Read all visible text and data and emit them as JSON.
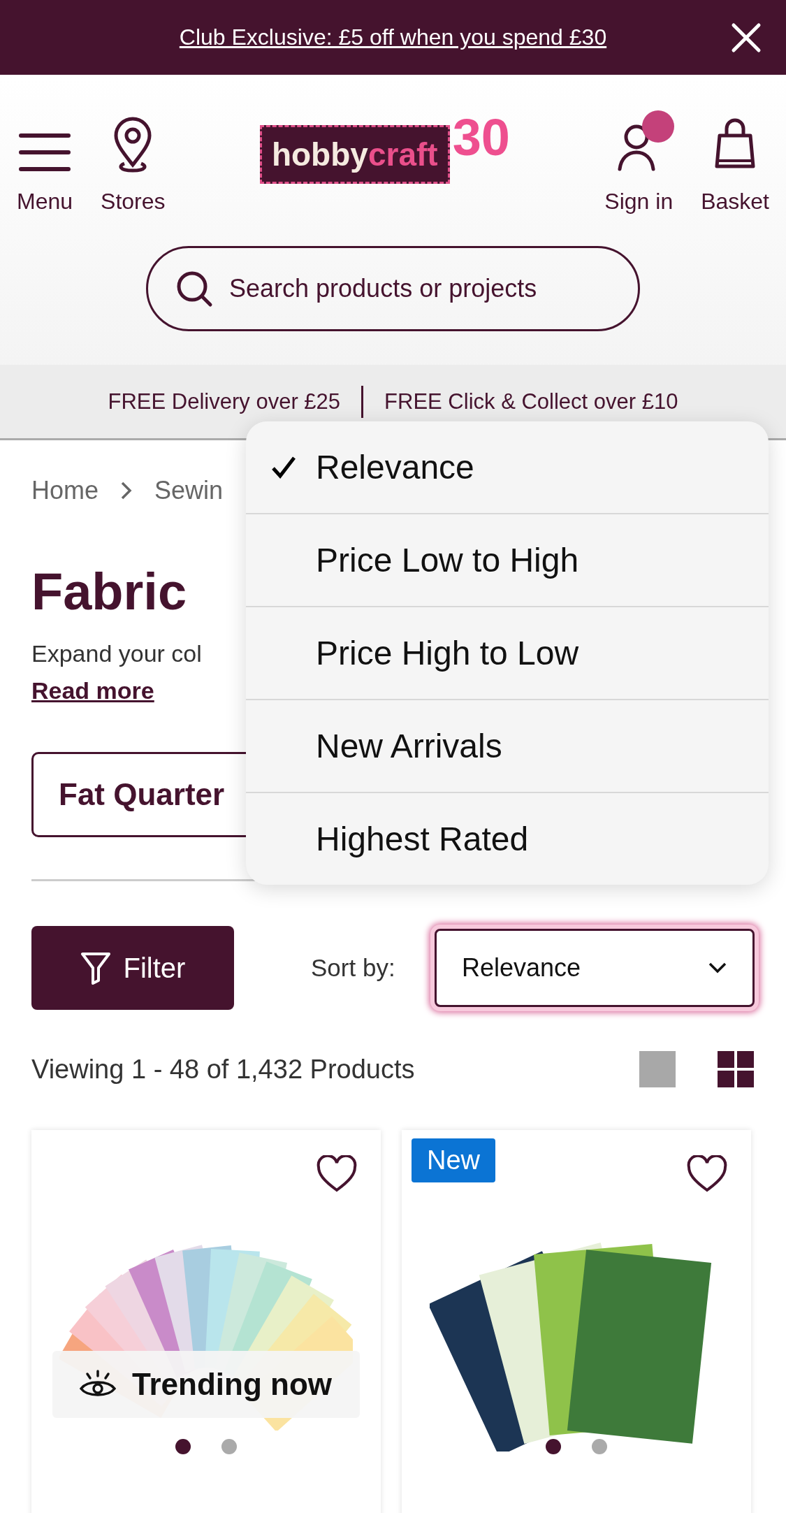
{
  "promo_banner": {
    "text": "Club Exclusive: £5 off when you spend £30"
  },
  "header": {
    "nav": [
      {
        "kind": "menu",
        "label": "Menu"
      },
      {
        "kind": "stores",
        "label": "Stores"
      }
    ],
    "logo": {
      "word_1": "hobby",
      "word_2": "craft",
      "badge": "30"
    },
    "account": [
      {
        "kind": "signin",
        "label": "Sign in",
        "notification": true
      },
      {
        "kind": "basket",
        "label": "Basket",
        "notification": false
      }
    ]
  },
  "search": {
    "placeholder": "Search products or projects"
  },
  "delivery_bar": [
    "FREE Delivery over £25",
    "FREE Click & Collect over £10"
  ],
  "breadcrumb": [
    "Home",
    "Sewin"
  ],
  "page": {
    "title": "Fabric",
    "description": "Expand your col",
    "read_more": "Read more"
  },
  "category_chips": [
    "Fat Quarter"
  ],
  "toolbar": {
    "filter": "Filter",
    "sort_label": "Sort by:",
    "sort_value": "Relevance"
  },
  "results": {
    "count": "Viewing 1 - 48 of 1,432 Products",
    "views": [
      {
        "kind": "single",
        "selected": false
      },
      {
        "kind": "grid",
        "selected": true
      }
    ]
  },
  "products": [
    {
      "trending": "Trending now",
      "dots": [
        {
          "selected": true
        },
        {
          "selected": false
        }
      ]
    },
    {
      "badge": "New",
      "dots": [
        {
          "selected": true
        },
        {
          "selected": false
        }
      ]
    }
  ],
  "sort_menu": [
    {
      "label": "Relevance",
      "selected": true
    },
    {
      "label": "Price Low to High",
      "selected": false
    },
    {
      "label": "Price High to Low",
      "selected": false
    },
    {
      "label": "New Arrivals",
      "selected": false
    },
    {
      "label": "Highest Rated",
      "selected": false
    }
  ]
}
